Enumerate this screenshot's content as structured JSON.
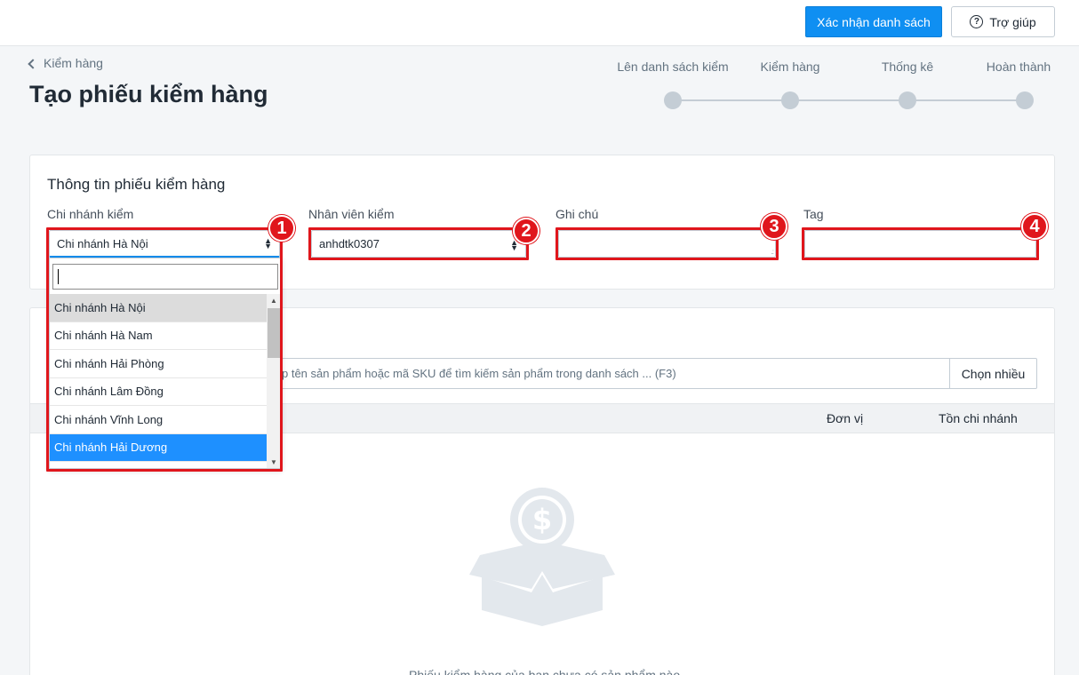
{
  "topbar": {
    "confirm_label": "Xác nhận danh sách",
    "help_label": "Trợ giúp",
    "help_icon_glyph": "?"
  },
  "breadcrumb": {
    "label": "Kiểm hàng"
  },
  "page": {
    "title": "Tạo phiếu kiểm hàng"
  },
  "steps": [
    {
      "label": "Lên danh sách kiểm"
    },
    {
      "label": "Kiểm hàng"
    },
    {
      "label": "Thống kê"
    },
    {
      "label": "Hoàn thành"
    }
  ],
  "info_card": {
    "title": "Thông tin phiếu kiểm hàng",
    "branch": {
      "label": "Chi nhánh kiểm",
      "value": "Chi nhánh Hà Nội"
    },
    "staff": {
      "label": "Nhân viên kiểm",
      "value": "anhdtk0307"
    },
    "note": {
      "label": "Ghi chú",
      "value": ""
    },
    "tag": {
      "label": "Tag",
      "value": ""
    }
  },
  "branch_dropdown": {
    "search_value": "",
    "options": [
      {
        "label": "Chi nhánh Hà Nội",
        "state": "hover"
      },
      {
        "label": "Chi nhánh Hà Nam",
        "state": ""
      },
      {
        "label": "Chi nhánh Hải Phòng",
        "state": ""
      },
      {
        "label": "Chi nhánh Lâm Đồng",
        "state": ""
      },
      {
        "label": "Chi nhánh Vĩnh Long",
        "state": ""
      },
      {
        "label": "Chi nhánh Hải Dương",
        "state": "selected"
      }
    ]
  },
  "product_card": {
    "search_placeholder": "p tên sản phẩm hoặc mã SKU để tìm kiếm sản phẩm trong danh sách ... (F3)",
    "choose_many_label": "Chọn nhiều",
    "columns": {
      "unit": "Đơn vị",
      "stock": "Tồn chi nhánh"
    },
    "empty_text": "Phiếu kiểm hàng của bạn chưa có sản phẩm nào"
  },
  "annotations": {
    "badge_1": "1",
    "badge_2": "2",
    "badge_3": "3",
    "badge_4": "4"
  },
  "colors": {
    "primary": "#0f8ff2",
    "annotation_red": "#e0161c",
    "selected_option": "#1e90ff",
    "step_gray": "#c4cdd5"
  }
}
